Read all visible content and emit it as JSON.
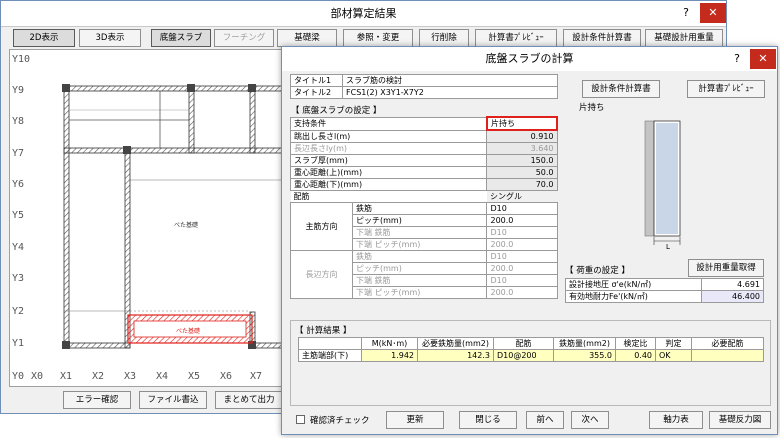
{
  "main_window": {
    "title": "部材算定結果",
    "help": "?",
    "close": "✕",
    "toolbar": {
      "view2d": "2D表示",
      "view3d": "3D表示",
      "slab": "底盤スラブ",
      "footing": "フーチング",
      "beam": "基礎梁",
      "ref_change": "参照・変更",
      "delete_row": "行削除",
      "preview": "計算書ﾌﾟﾚﾋﾞｭｰ",
      "design_calc": "設計条件計算書",
      "base_weight": "基礎設計用重量"
    },
    "canvas": {
      "y_labels": [
        "Y10",
        "Y9",
        "Y8",
        "Y7",
        "Y6",
        "Y5",
        "Y4",
        "Y3",
        "Y2",
        "Y1",
        "Y0"
      ],
      "x_labels": [
        "X0",
        "X1",
        "X2",
        "X3",
        "X4",
        "X5",
        "X6",
        "X7"
      ],
      "marker_upper": "べた基礎",
      "marker_lower": "べた基礎"
    },
    "bottom_buttons": {
      "error_check": "エラー確認",
      "file_write": "ファイル書込",
      "batch_output": "まとめて出力"
    }
  },
  "dialog": {
    "title": "底盤スラブの計算",
    "help": "?",
    "close": "✕",
    "title_rows": [
      {
        "label": "タイトル1",
        "value": "スラブ筋の検討"
      },
      {
        "label": "タイトル2",
        "value": "FCS1(2) X3Y1-X7Y2"
      }
    ],
    "slab_settings_header": "【 底盤スラブの設定 】",
    "support_label": "支持条件",
    "support_value": "片持ち",
    "rows": [
      {
        "label": "跳出し長さl(m)",
        "value": "0.910",
        "disabled": false
      },
      {
        "label": "長辺長さly(m)",
        "value": "3.640",
        "disabled": true
      },
      {
        "label": "スラブ厚(mm)",
        "value": "150.0",
        "disabled": false
      },
      {
        "label": "重心距離(上)(mm)",
        "value": "50.0",
        "disabled": false
      },
      {
        "label": "重心距離(下)(mm)",
        "value": "70.0",
        "disabled": false
      }
    ],
    "haikin_label": "配筋",
    "haikin_value": "シングル",
    "main_dir": {
      "label": "主筋方向",
      "rows": [
        {
          "label": "鉄筋",
          "value": "D10",
          "disabled": false
        },
        {
          "label": "ピッチ(mm)",
          "value": "200.0",
          "disabled": false
        },
        {
          "label": "下端 鉄筋",
          "value": "D10",
          "disabled": true
        },
        {
          "label": "下端 ピッチ(mm)",
          "value": "200.0",
          "disabled": true
        }
      ]
    },
    "long_dir": {
      "label": "長辺方向",
      "rows": [
        {
          "label": "鉄筋",
          "value": "D10",
          "disabled": true
        },
        {
          "label": "ピッチ(mm)",
          "value": "200.0",
          "disabled": true
        },
        {
          "label": "下端 鉄筋",
          "value": "D10",
          "disabled": true
        },
        {
          "label": "下端 ピッチ(mm)",
          "value": "200.0",
          "disabled": true
        }
      ]
    },
    "right": {
      "design_calc_button": "設計条件計算書",
      "preview_button": "計算書ﾌﾟﾚﾋﾞｭｰ",
      "diagram_label": "片持ち",
      "diagram_l": "L",
      "load_header": "【 荷重の設定 】",
      "weight_button": "設計用重量取得",
      "load_rows": [
        {
          "label": "設計接地圧 σ'e(kN/㎡)",
          "value": "4.691"
        },
        {
          "label": "有効地耐力Fe'(kN/㎡)",
          "value": "46.400"
        }
      ]
    },
    "results": {
      "header": "【 計算結果 】",
      "columns": [
        "",
        "M(kN･m)",
        "必要鉄筋量(mm2)",
        "配筋",
        "鉄筋量(mm2)",
        "検定比",
        "判定",
        "必要配筋"
      ],
      "rows": [
        [
          "主筋端部(下)",
          "1.942",
          "142.3",
          "D10@200",
          "355.0",
          "0.40",
          "OK",
          ""
        ]
      ]
    },
    "footer": {
      "confirm_check": "確認済チェック",
      "update": "更新",
      "close": "閉じる",
      "prev": "前へ",
      "next": "次へ",
      "axial": "軸力表",
      "reaction": "基礎反力図"
    }
  },
  "colors": {
    "accent_red": "#e0201a",
    "result_row": "#ffffc0",
    "load_value_bg": "#e8e8f8",
    "slab_fill": "#c8d6e8"
  }
}
